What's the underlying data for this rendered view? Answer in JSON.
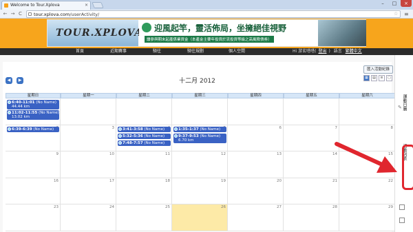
{
  "browser": {
    "tab_title": "Welcome to Tour.Xplova",
    "tab_close": "×",
    "new_tab": "",
    "window_buttons": {
      "minimize": "–",
      "maximize": "□",
      "close": "×"
    },
    "url_host": "tour.xplova.com",
    "url_path": "/userActivity/",
    "nav": {
      "back": "←",
      "forward": "→",
      "reload": "C"
    },
    "star": "☆",
    "menu": "≡"
  },
  "banner": {
    "logo": "TOUR.XPLOVA",
    "headline": "迎風起竿，靈活佈局，坐擁絕佳視野",
    "subline": "讀參與期末起產係業資金（本產金主要年投資於流投資等級之高風險債券）"
  },
  "site_nav": {
    "items": [
      "首頁",
      "近期賽事",
      "騎往",
      "騎往規劃",
      "個人空間"
    ],
    "user_greeting": "Hi 游玄嗒嗒(",
    "logout": "登出",
    "close_paren": ")",
    "lang_label": "語言",
    "lang_value": "繁體中文"
  },
  "calendar": {
    "title": "十二月 2012",
    "prev": "◀",
    "next": "▶",
    "add_log": "匯入活動紀錄",
    "view_buttons": [
      "▦",
      "▤",
      "≡",
      "▢"
    ],
    "weekdays": [
      "星期日",
      "星期一",
      "星期二",
      "星期三",
      "星期四",
      "星期五",
      "星期六"
    ],
    "weeks": [
      [
        "",
        "",
        "",
        "",
        "",
        "",
        ""
      ],
      [
        "2",
        "3",
        "4",
        "5",
        "6",
        "7",
        "8"
      ],
      [
        "9",
        "10",
        "11",
        "12",
        "13",
        "14",
        "15"
      ],
      [
        "16",
        "17",
        "18",
        "19",
        "20",
        "21",
        "22"
      ],
      [
        "23",
        "24",
        "25",
        "26",
        "27",
        "28",
        "29"
      ]
    ],
    "today_index": {
      "week": 4,
      "day": 3
    },
    "events": [
      {
        "week": 0,
        "day": 0,
        "slot": 0,
        "time": "6:40-11:01",
        "name": "(No Name)",
        "dist": "44.44 km"
      },
      {
        "week": 0,
        "day": 0,
        "slot": 1,
        "time": "11:02-11:55",
        "name": "(No Name)",
        "dist": "13.02 km"
      },
      {
        "week": 1,
        "day": 0,
        "slot": 0,
        "time": "6:39-6:39",
        "name": "(No Name)",
        "dist": ""
      },
      {
        "week": 1,
        "day": 2,
        "slot": 0,
        "time": "3:41-3:58",
        "name": "(No Name)",
        "dist": ""
      },
      {
        "week": 1,
        "day": 2,
        "slot": 1,
        "time": "5:32-5:36",
        "name": "(No Name)",
        "dist": ""
      },
      {
        "week": 1,
        "day": 2,
        "slot": 2,
        "time": "7:48-7:57",
        "name": "(No Name)",
        "dist": ""
      },
      {
        "week": 1,
        "day": 3,
        "slot": 0,
        "time": "1:35-1:37",
        "name": "(No Name)",
        "dist": ""
      },
      {
        "week": 1,
        "day": 3,
        "slot": 1,
        "time": "9:37-9:53",
        "name": "(No Name)",
        "dist": "6.70 km"
      }
    ]
  },
  "right_panel": {
    "item_1": "運動日曆",
    "item_2": "活動列表",
    "pencil": "✎"
  },
  "colors": {
    "header_orange": "#f7a51c",
    "event_blue": "#3a62c4",
    "today_yellow": "#fdeaa7",
    "highlight_red": "#e0262e"
  }
}
